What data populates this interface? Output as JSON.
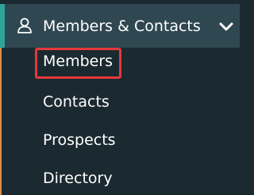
{
  "sidebar": {
    "group": {
      "label": "Members & Contacts",
      "icon": "person-icon",
      "expand_icon": "chevron-down-icon"
    },
    "items": [
      {
        "label": "Members"
      },
      {
        "label": "Contacts"
      },
      {
        "label": "Prospects"
      },
      {
        "label": "Directory"
      }
    ]
  },
  "colors": {
    "background": "#1b2a30",
    "header_background": "#2f4750",
    "accent": "#2ea39a",
    "highlight": "#e5383b",
    "text": "#ffffff"
  }
}
